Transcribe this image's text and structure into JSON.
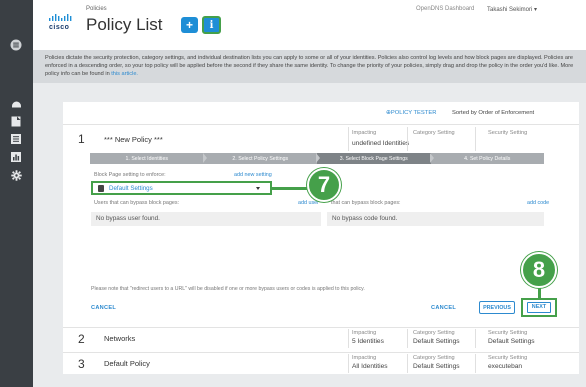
{
  "header": {
    "breadcrumb": "Policies",
    "title": "Policy List",
    "nav_dashboard": "OpenDNS Dashboard",
    "nav_user": "Takashi Sekimori ▾",
    "logo_text": "cisco"
  },
  "description": {
    "text": "Policies dictate the security protection, category settings, and individual destination lists you can apply to some or all of your identities.  Policies also control log levels and how block pages are displayed. Policies are enforced in a descending order, so your top policy will be applied before the second if they share the same identity. To change the priority of your policies, simply drag and drop the policy in the order you'd like.  More policy info can be found in ",
    "link": "this article."
  },
  "toolbar": {
    "policy_tester": "⊕POLICY TESTER",
    "sorted": "Sorted by Order of Enforcement"
  },
  "policy1": {
    "number": "1",
    "name": "*** New Policy ***",
    "impacting_label": "Impacting",
    "impacting_value": "undefined Identities",
    "category_label": "Category Setting",
    "security_label": "Security Setting"
  },
  "steps": [
    {
      "label": "1. Select Identities"
    },
    {
      "label": "2. Select Policy Settings"
    },
    {
      "label": "3. Select Block Page Settings"
    },
    {
      "label": "4. Set Policy Details"
    }
  ],
  "form": {
    "block_page_label": "Block Page setting to enforce:",
    "add_new_setting": "add new setting",
    "select_value": "Default Settings",
    "users_label": "Users that can bypass block pages:",
    "add_user": "add user",
    "codes_label": "that can bypass block pages:",
    "add_code": "add code",
    "no_user": "No bypass user found.",
    "no_code": "No bypass code found.",
    "note": "Please note that \"redirect users to a URL\" will be disabled if one or more bypass users or codes is applied to this policy.",
    "cancel_left": "CANCEL",
    "cancel_right": "CANCEL",
    "previous": "PREVIOUS",
    "next": "NEXT"
  },
  "callouts": {
    "seven": "7",
    "eight": "8"
  },
  "policy2": {
    "number": "2",
    "name": "Networks",
    "impacting_label": "Impacting",
    "impacting_value": "5 Identities",
    "category_label": "Category Setting",
    "category_value": "Default Settings",
    "security_label": "Security Setting",
    "security_value": "Default Settings"
  },
  "policy3": {
    "number": "3",
    "name": "Default Policy",
    "impacting_label": "Impacting",
    "impacting_value": "All Identities",
    "category_label": "Category Setting",
    "category_value": "Default Settings",
    "security_label": "Security Setting",
    "security_value": "executeban"
  },
  "colors": {
    "sidebar": "#3a3f44",
    "accent_blue": "#2d8acf",
    "callout_green": "#45a04a",
    "step_bar": "#a8acb0"
  },
  "icons": [
    "menu-icon",
    "dashboard-icon",
    "reports-icon",
    "policies-icon",
    "chart-icon",
    "settings-icon",
    "plus-icon",
    "info-icon",
    "document-icon",
    "caret-down-icon"
  ]
}
